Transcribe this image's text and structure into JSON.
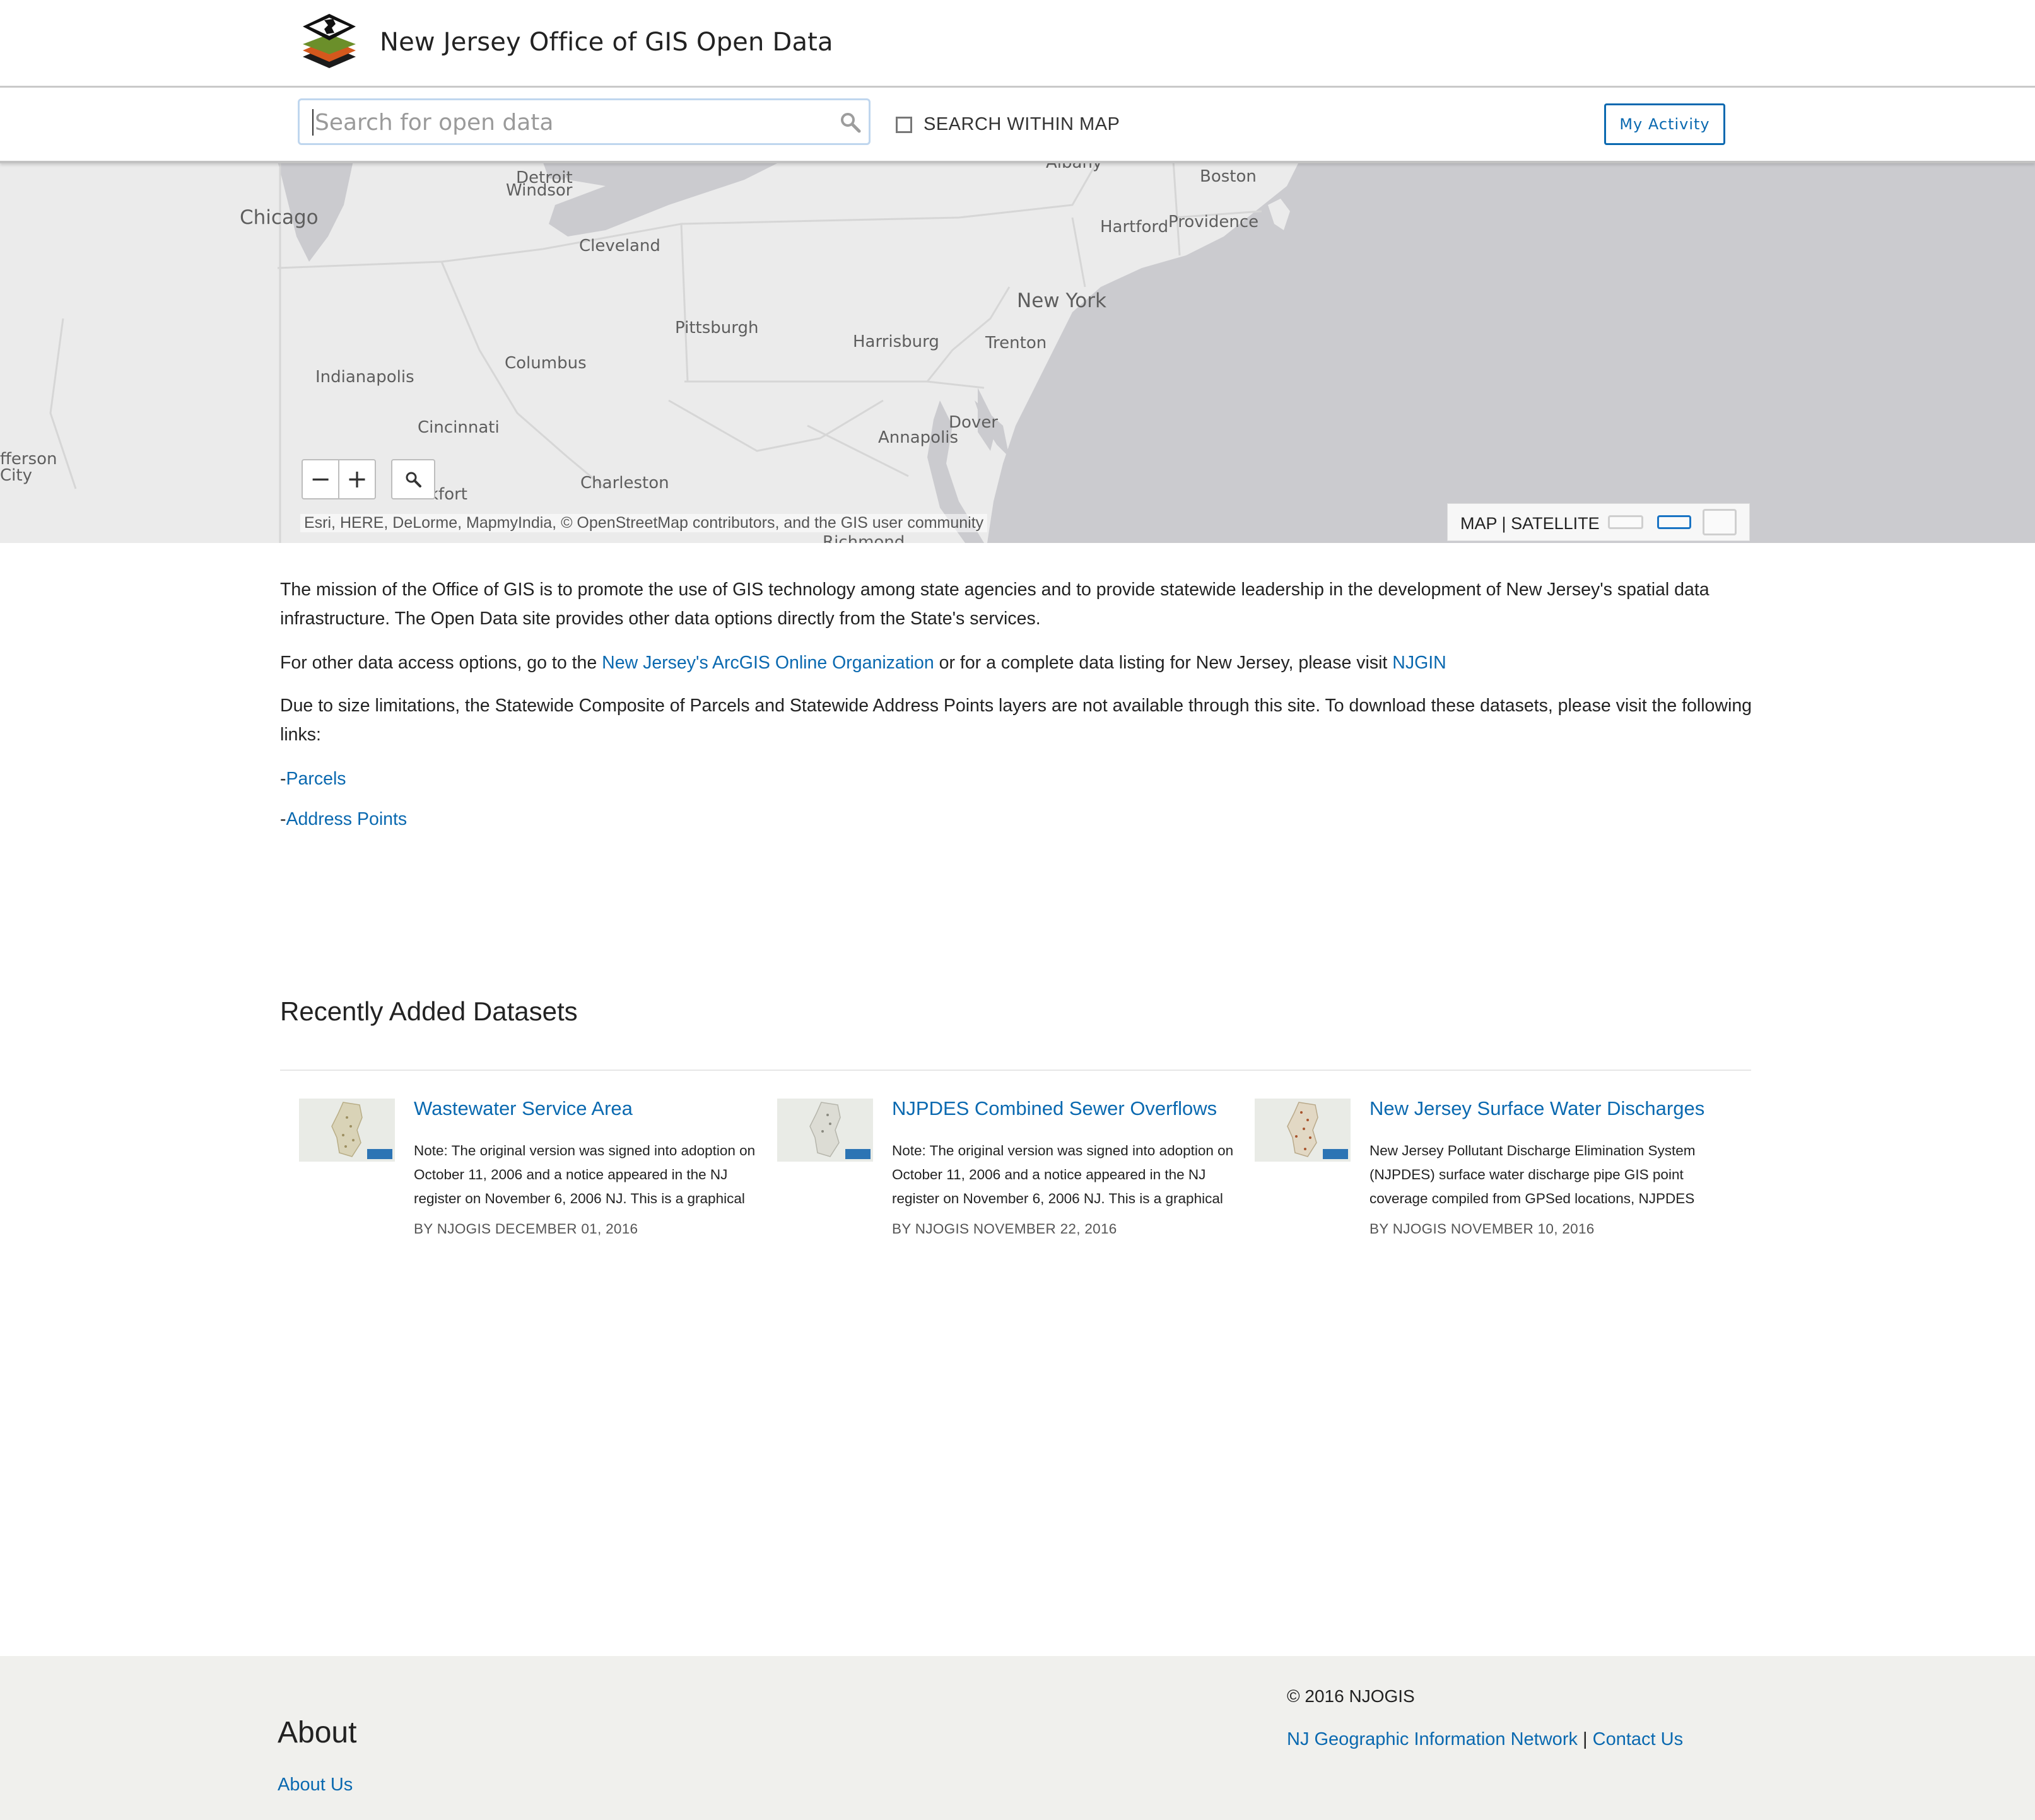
{
  "header": {
    "site_title": "New Jersey Office of GIS Open Data"
  },
  "search": {
    "placeholder": "Search for open data",
    "within_map_label": "SEARCH WITHIN MAP",
    "within_map_checked": false,
    "my_activity_label": "My Activity"
  },
  "map": {
    "cities": [
      "Detroit",
      "Windsor",
      "Chicago",
      "Cleveland",
      "Albany",
      "Boston",
      "Hartford",
      "Providence",
      "New York",
      "Pittsburgh",
      "Harrisburg",
      "Trenton",
      "Indianapolis",
      "Columbus",
      "Cincinnati",
      "Dover",
      "Annapolis",
      "Charleston",
      "fferson",
      "City",
      "kfort",
      "Richmond"
    ],
    "zoom_out_label": "−",
    "zoom_in_label": "+",
    "attribution": "Esri, HERE, DeLorme, MapmyIndia, © OpenStreetMap contributors, and the GIS user community",
    "basemap_map": "MAP",
    "basemap_separator": "|",
    "basemap_satellite": "SATELLITE",
    "colors": {
      "land": "#ebebeb",
      "water": "#cbcbcf",
      "boundary": "#dadada"
    }
  },
  "intro": {
    "p1": "The mission of the Office of GIS is to promote the use of GIS technology among state agencies and to provide statewide leadership in the development of New Jersey's spatial data infrastructure. The Open Data site provides other data options directly from the State's services.",
    "p2_prefix": "For other data access options, go to the ",
    "p2_link1": "New Jersey's ArcGIS Online Organization",
    "p2_middle": " or for a complete data listing for New Jersey, please visit ",
    "p2_link2": "NJGIN",
    "p3": "Due to size limitations, the Statewide Composite of Parcels and Statewide Address Points layers are not available through this site. To download these datasets, please visit the following links:",
    "dash": "-",
    "link_parcels": "Parcels",
    "link_address_points": "Address Points"
  },
  "recent": {
    "title": "Recently Added Datasets",
    "cards": [
      {
        "title": "Wastewater Service Area",
        "description": "Note: The original version was signed into adoption on October 11, 2006 and a notice appeared in the NJ register on November 6, 2006 NJ. This is a graphical",
        "byline": "BY NJOGIS DECEMBER 01, 2016"
      },
      {
        "title": "NJPDES Combined Sewer Overflows",
        "description": "Note: The original version was signed into adoption on October 11, 2006 and a notice appeared in the NJ register on November 6, 2006 NJ. This is a graphical",
        "byline": "BY NJOGIS NOVEMBER 22, 2016"
      },
      {
        "title": "New Jersey Surface Water Discharges",
        "description": "New Jersey Pollutant Discharge Elimination System (NJPDES) surface water discharge pipe GIS point coverage compiled from GPSed locations, NJPDES",
        "byline": "BY NJOGIS NOVEMBER 10, 2016"
      }
    ]
  },
  "footer": {
    "about_heading": "About",
    "about_link": "About Us",
    "copyright": "© 2016 NJOGIS",
    "link_njgin": "NJ Geographic Information Network",
    "separator": "|",
    "link_contact": "Contact Us"
  },
  "colors": {
    "link": "#0a69b0",
    "footer_bg": "#f0f0ed",
    "accent_border": "#bfd6ee"
  }
}
